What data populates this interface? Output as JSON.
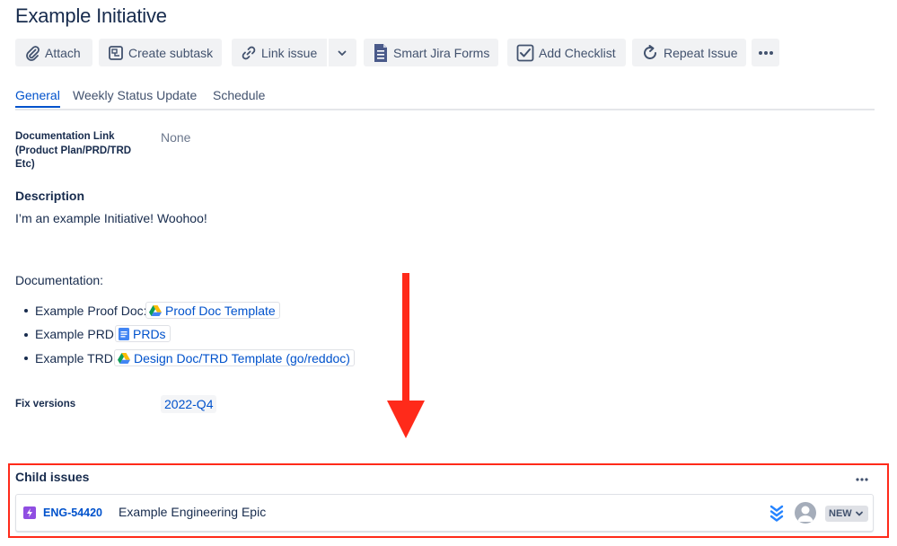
{
  "issue": {
    "title": "Example Initiative"
  },
  "toolbar": {
    "attach": "Attach",
    "create_subtask": "Create subtask",
    "link_issue": "Link issue",
    "smart_jira_forms": "Smart Jira Forms",
    "add_checklist": "Add Checklist",
    "repeat_issue": "Repeat Issue"
  },
  "tabs": [
    "General",
    "Weekly Status Update",
    "Schedule"
  ],
  "fields": {
    "documentation_link": {
      "label_lines": [
        "Documentation Link",
        "(Product Plan/PRD/TRD",
        "Etc)"
      ],
      "value": "None"
    },
    "description": {
      "heading": "Description",
      "text": "I’m an example Initiative! Woohoo!",
      "documentation_heading": "Documentation:",
      "links": [
        {
          "prefix": "Example Proof Doc:",
          "text": "Proof Doc Template",
          "icon": "google-drive-icon"
        },
        {
          "prefix": "Example PRD:",
          "text": "PRDs",
          "icon": "google-docs-icon"
        },
        {
          "prefix": "Example TRD:",
          "text": "Design Doc/TRD Template (go/reddoc)",
          "icon": "google-drive-icon"
        }
      ]
    },
    "fix_versions": {
      "label": "Fix versions",
      "value": "2022-Q4"
    }
  },
  "child_issues": {
    "heading": "Child issues",
    "items": [
      {
        "key": "ENG-54420",
        "summary": "Example Engineering Epic",
        "status": "NEW",
        "type_icon": "epic-icon",
        "priority_icon": "priority-lowest-icon"
      }
    ]
  },
  "colors": {
    "accent": "#0052cc",
    "annotation": "#ff2a1a",
    "epic": "#904ee2"
  }
}
